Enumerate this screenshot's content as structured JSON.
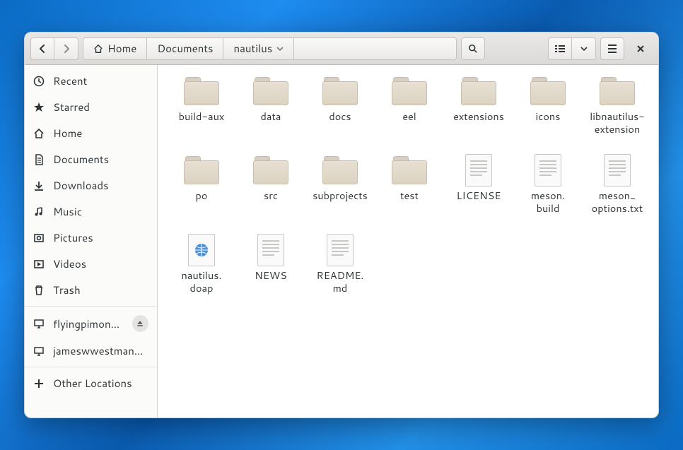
{
  "path": {
    "home_label": "Home",
    "segments": [
      "Documents",
      "nautilus"
    ]
  },
  "sidebar": {
    "places": [
      {
        "icon": "clock",
        "label": "Recent"
      },
      {
        "icon": "star",
        "label": "Starred"
      },
      {
        "icon": "home",
        "label": "Home"
      },
      {
        "icon": "doc",
        "label": "Documents"
      },
      {
        "icon": "download",
        "label": "Downloads"
      },
      {
        "icon": "music",
        "label": "Music"
      },
      {
        "icon": "pictures",
        "label": "Pictures"
      },
      {
        "icon": "videos",
        "label": "Videos"
      },
      {
        "icon": "trash",
        "label": "Trash"
      }
    ],
    "devices": [
      {
        "icon": "remote",
        "label": "flyingpimons…",
        "eject": true
      },
      {
        "icon": "remote",
        "label": "jameswwestman…",
        "eject": false
      }
    ],
    "other_label": "Other Locations"
  },
  "files": [
    {
      "type": "folder",
      "name": "build-aux"
    },
    {
      "type": "folder",
      "name": "data"
    },
    {
      "type": "folder",
      "name": "docs"
    },
    {
      "type": "folder",
      "name": "eel"
    },
    {
      "type": "folder",
      "name": "extensions"
    },
    {
      "type": "folder",
      "name": "icons"
    },
    {
      "type": "folder",
      "name": "libnautilus-extension"
    },
    {
      "type": "folder",
      "name": "po"
    },
    {
      "type": "folder",
      "name": "src"
    },
    {
      "type": "folder",
      "name": "subprojects"
    },
    {
      "type": "folder",
      "name": "test"
    },
    {
      "type": "text",
      "name": "LICENSE"
    },
    {
      "type": "text",
      "name": "meson.\nbuild"
    },
    {
      "type": "text",
      "name": "meson_\noptions.txt"
    },
    {
      "type": "globe",
      "name": "nautilus.\ndoap"
    },
    {
      "type": "text",
      "name": "NEWS"
    },
    {
      "type": "text",
      "name": "README.\nmd"
    }
  ]
}
